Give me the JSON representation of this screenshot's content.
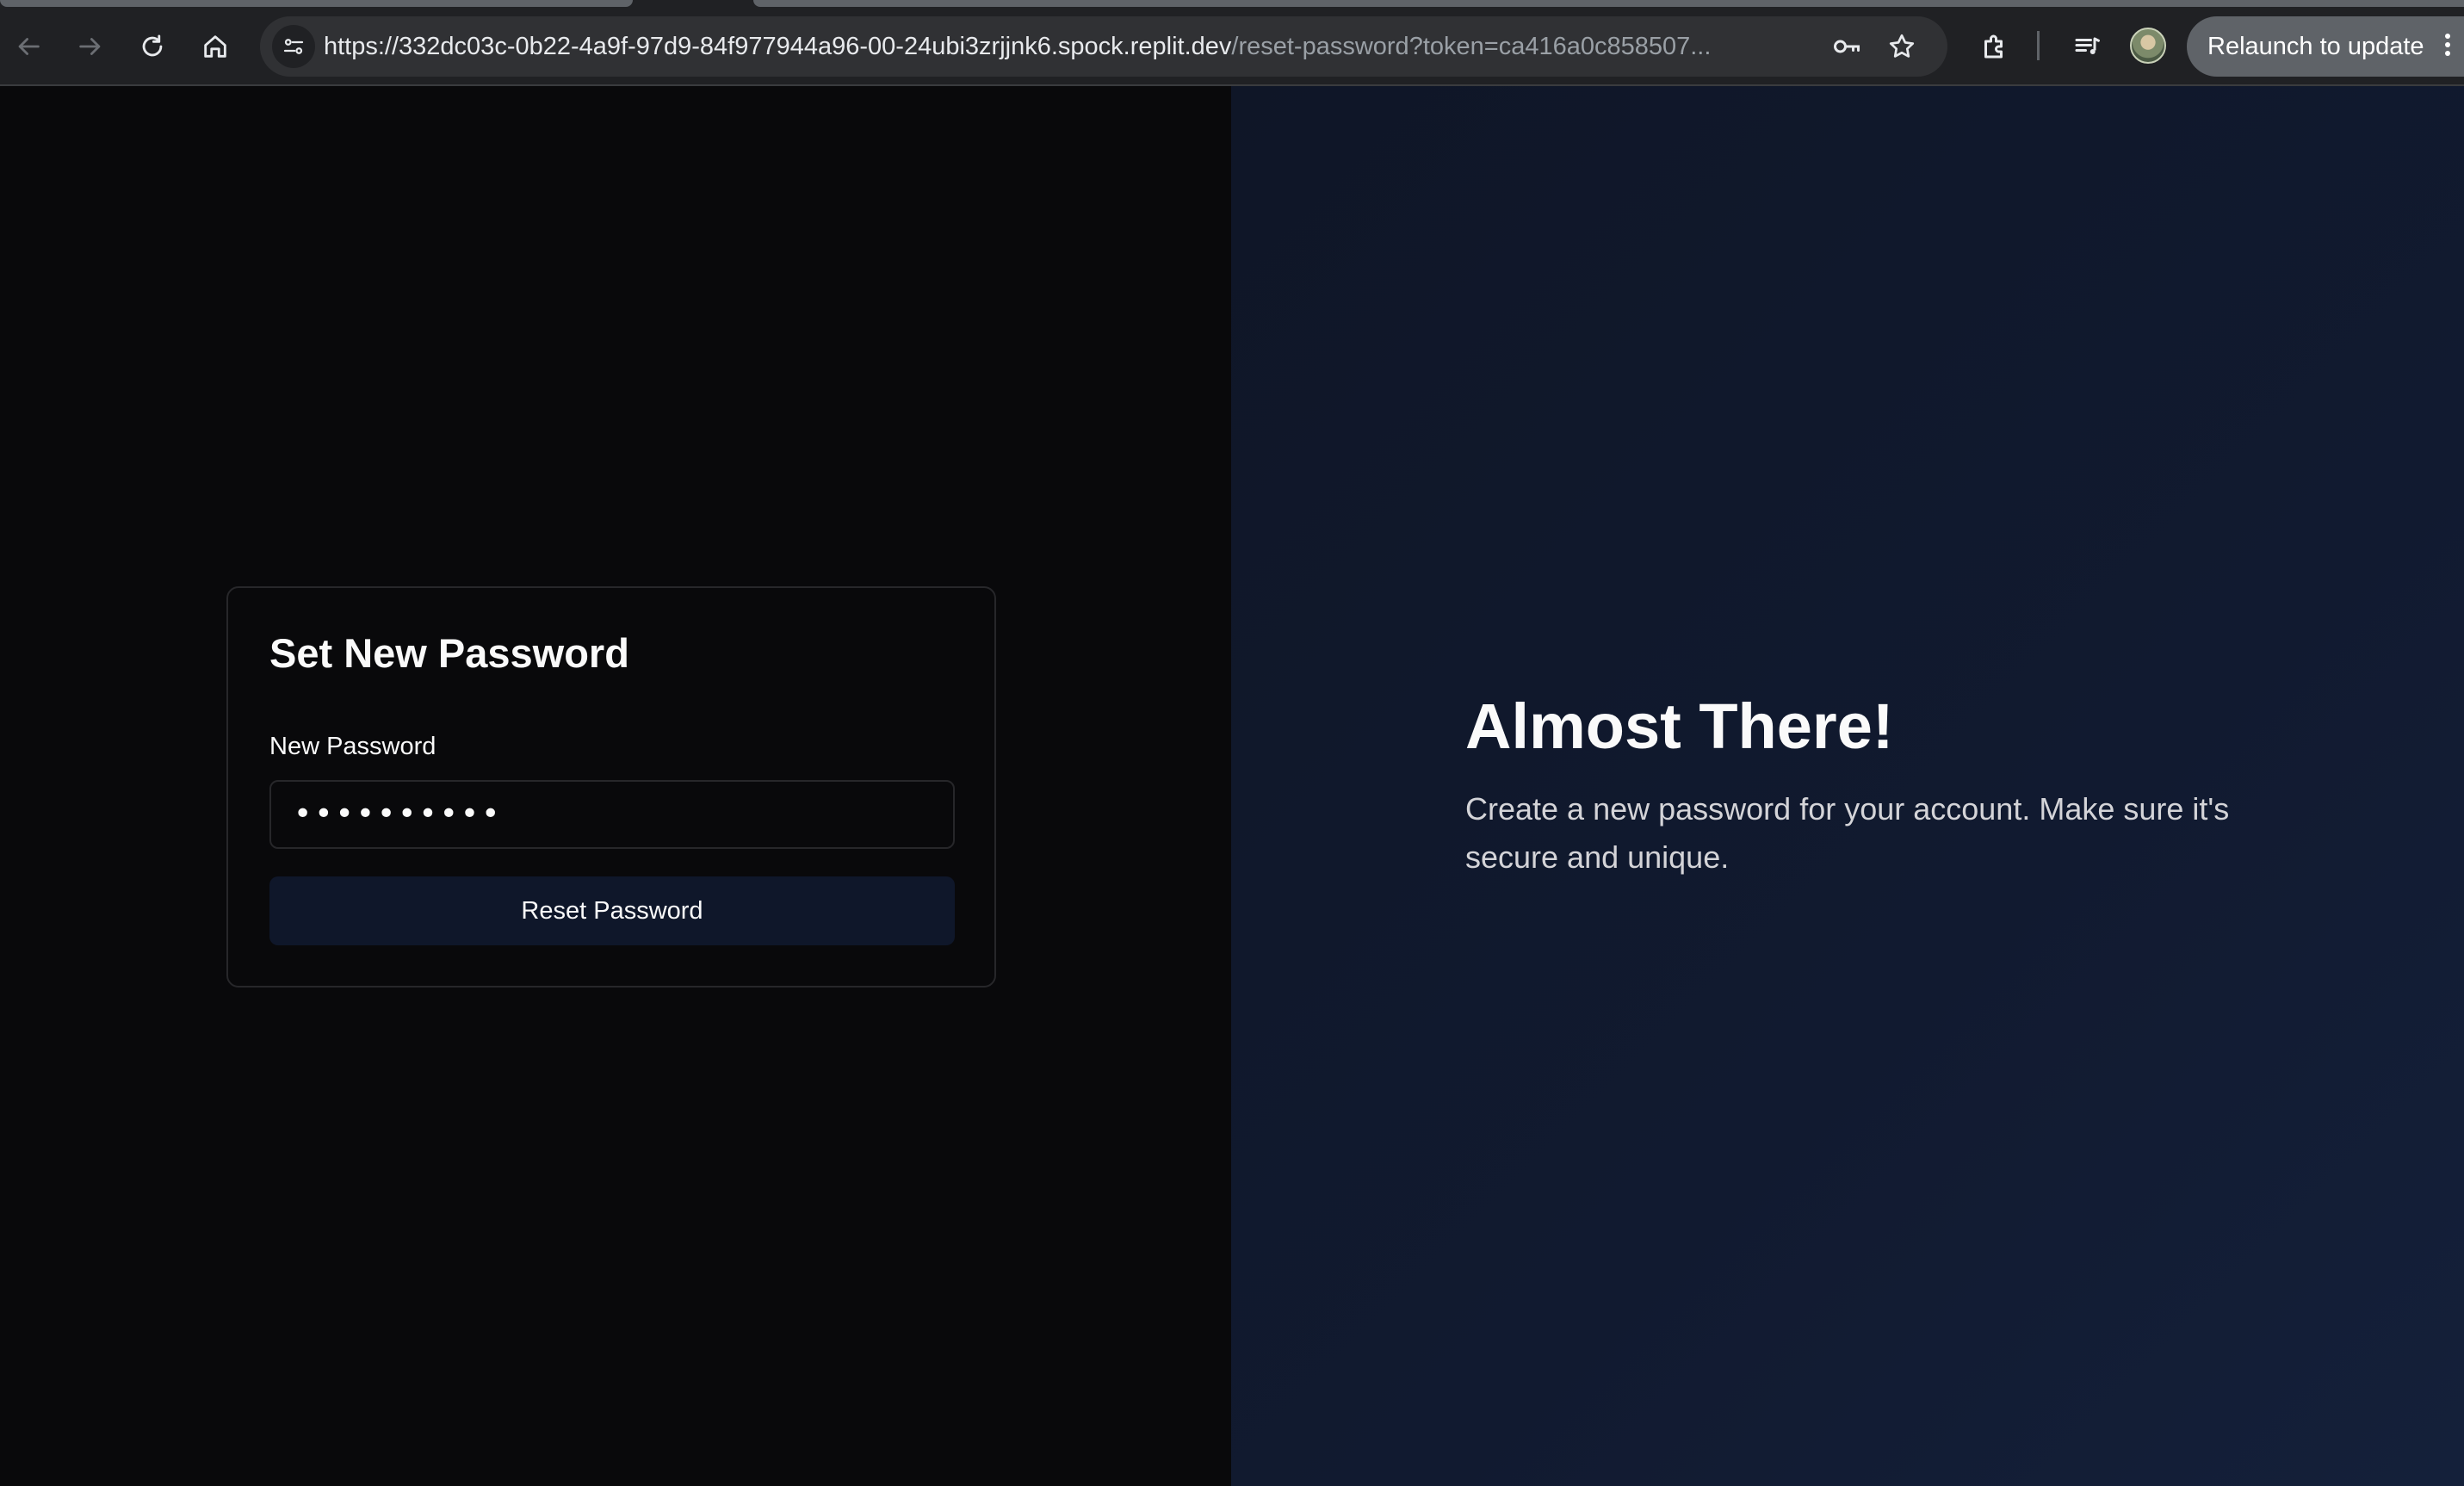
{
  "browser": {
    "url_host": "https://332dc03c-0b22-4a9f-97d9-84f977944a96-00-24ubi3zrjjnk6.spock.replit.dev",
    "url_path": "/reset-password?token=ca416a0c858507...",
    "relaunch_label": "Relaunch to update",
    "icons": [
      "back-arrow-icon",
      "forward-arrow-icon",
      "reload-icon",
      "home-icon",
      "site-info-icon",
      "password-key-icon",
      "bookmark-star-icon",
      "extensions-icon",
      "media-controls-icon",
      "profile-avatar",
      "more-menu-icon"
    ]
  },
  "card": {
    "title": "Set New Password",
    "password_label": "New Password",
    "password_value": "••••••••••",
    "submit_label": "Reset Password"
  },
  "hero": {
    "title": "Almost There!",
    "description": "Create a new password for your account. Make sure it's secure and unique."
  },
  "colors": {
    "left_background": "#09090b",
    "right_background": "#0f1627",
    "button_background": "#0f172a",
    "border": "#27272a"
  }
}
